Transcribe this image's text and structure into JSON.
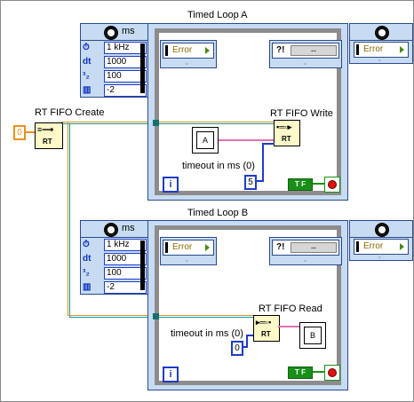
{
  "rt_fifo_create": {
    "label": "RT FIFO Create",
    "icon_text": "RT",
    "const_value": "0"
  },
  "loop_a": {
    "title": "Timed Loop A",
    "input_node": {
      "unit": "ms",
      "rows": [
        {
          "icon": "clock-source-icon",
          "symbol": "⏱",
          "value": "1 kHz"
        },
        {
          "icon": "dt-icon",
          "symbol": "dt",
          "value": "1000"
        },
        {
          "icon": "offset-icon",
          "symbol": "³₂",
          "value": "100"
        },
        {
          "icon": "processor-icon",
          "symbol": "▥",
          "value": "-2"
        }
      ]
    },
    "left_error": "Error",
    "right_error": "Error",
    "dropdown_symbol": "?!",
    "dropdown_value": "--",
    "ctrl_label": "A",
    "timeout_label": "timeout in ms (0)",
    "timeout_value": "5",
    "function_label": "RT FIFO Write",
    "function_icon_text": "RT",
    "iteration_symbol": "i",
    "tf_text": "T F"
  },
  "loop_b": {
    "title": "Timed Loop B",
    "input_node": {
      "unit": "ms",
      "rows": [
        {
          "icon": "clock-source-icon",
          "symbol": "⏱",
          "value": "1 kHz"
        },
        {
          "icon": "dt-icon",
          "symbol": "dt",
          "value": "1000"
        },
        {
          "icon": "offset-icon",
          "symbol": "³₂",
          "value": "100"
        },
        {
          "icon": "processor-icon",
          "symbol": "▥",
          "value": "-2"
        }
      ]
    },
    "left_error": "Error",
    "right_error": "Error",
    "dropdown_symbol": "?!",
    "dropdown_value": "--",
    "ind_label": "B",
    "timeout_label": "timeout in ms (0)",
    "timeout_value": "0",
    "function_label": "RT FIFO Read",
    "function_icon_text": "RT",
    "iteration_symbol": "i",
    "tf_text": "T F"
  },
  "colors": {
    "wire_fifo": "#e8901c",
    "wire_ref": "#0aa0a0",
    "loop_frame": "#c7dcf2",
    "integer_wire": "#1e3cc8",
    "stop_red": "#e01010",
    "bool_green": "#189018"
  }
}
